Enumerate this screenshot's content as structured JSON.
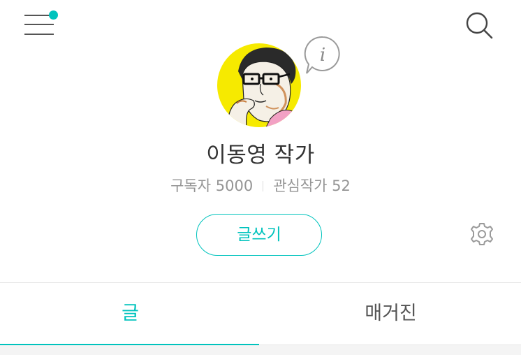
{
  "header": {
    "menu_icon": "hamburger-menu-icon",
    "notification_dot_color": "#00c3bd",
    "search_icon": "search-icon"
  },
  "profile": {
    "name": "이동영 작가",
    "avatar_icon": "author-avatar-illustration",
    "info_icon": "info-speech-bubble-icon",
    "stats": {
      "subscribers_label": "구독자",
      "subscribers_count": "5000",
      "following_label": "관심작가",
      "following_count": "52"
    },
    "write_button_label": "글쓰기",
    "settings_icon": "gear-icon"
  },
  "tabs": [
    {
      "label": "글",
      "active": true
    },
    {
      "label": "매거진",
      "active": false
    }
  ],
  "colors": {
    "accent": "#00c3bd",
    "text": "#333333",
    "muted": "#959595",
    "avatar_bg": "#f6ea00"
  }
}
